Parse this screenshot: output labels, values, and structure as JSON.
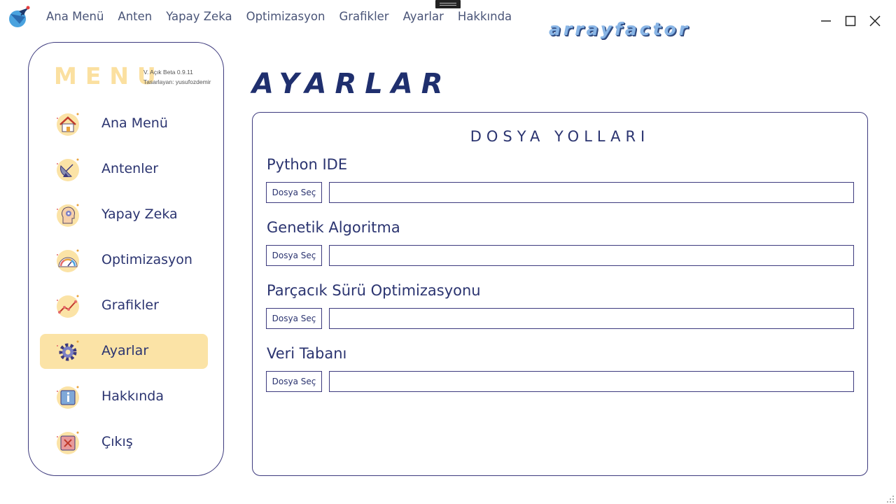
{
  "topbar": {
    "menu": [
      "Ana Menü",
      "Anten",
      "Yapay Zeka",
      "Optimizasyon",
      "Grafikler",
      "Ayarlar",
      "Hakkında"
    ],
    "brand": "arrayfactor"
  },
  "sidebar": {
    "title": "MENU",
    "version": "V. Açık Beta 0.9.11",
    "designer": "Tasarlayan: yusufozdemir",
    "items": [
      {
        "label": "Ana Menü",
        "icon": "home-icon"
      },
      {
        "label": "Antenler",
        "icon": "satellite-dish-icon"
      },
      {
        "label": "Yapay Zeka",
        "icon": "ai-brain-icon"
      },
      {
        "label": "Optimizasyon",
        "icon": "speedometer-icon"
      },
      {
        "label": "Grafikler",
        "icon": "line-chart-icon"
      },
      {
        "label": "Ayarlar",
        "icon": "gear-icon",
        "active": true
      },
      {
        "label": "Hakkında",
        "icon": "info-icon"
      },
      {
        "label": "Çıkış",
        "icon": "exit-icon"
      }
    ]
  },
  "main": {
    "title": "AYARLAR",
    "panel_title": "DOSYA YOLLARI",
    "paths": [
      {
        "label": "Python IDE",
        "button": "Dosya Seç",
        "value": ""
      },
      {
        "label": "Genetik Algoritma",
        "button": "Dosya Seç",
        "value": ""
      },
      {
        "label": "Parçacık Sürü Optimizasyonu",
        "button": "Dosya Seç",
        "value": ""
      },
      {
        "label": "Veri Tabanı",
        "button": "Dosya Seç",
        "value": ""
      }
    ]
  },
  "colors": {
    "accent": "#fbe3a6",
    "border": "#3d3a7d",
    "text": "#2b3470"
  }
}
